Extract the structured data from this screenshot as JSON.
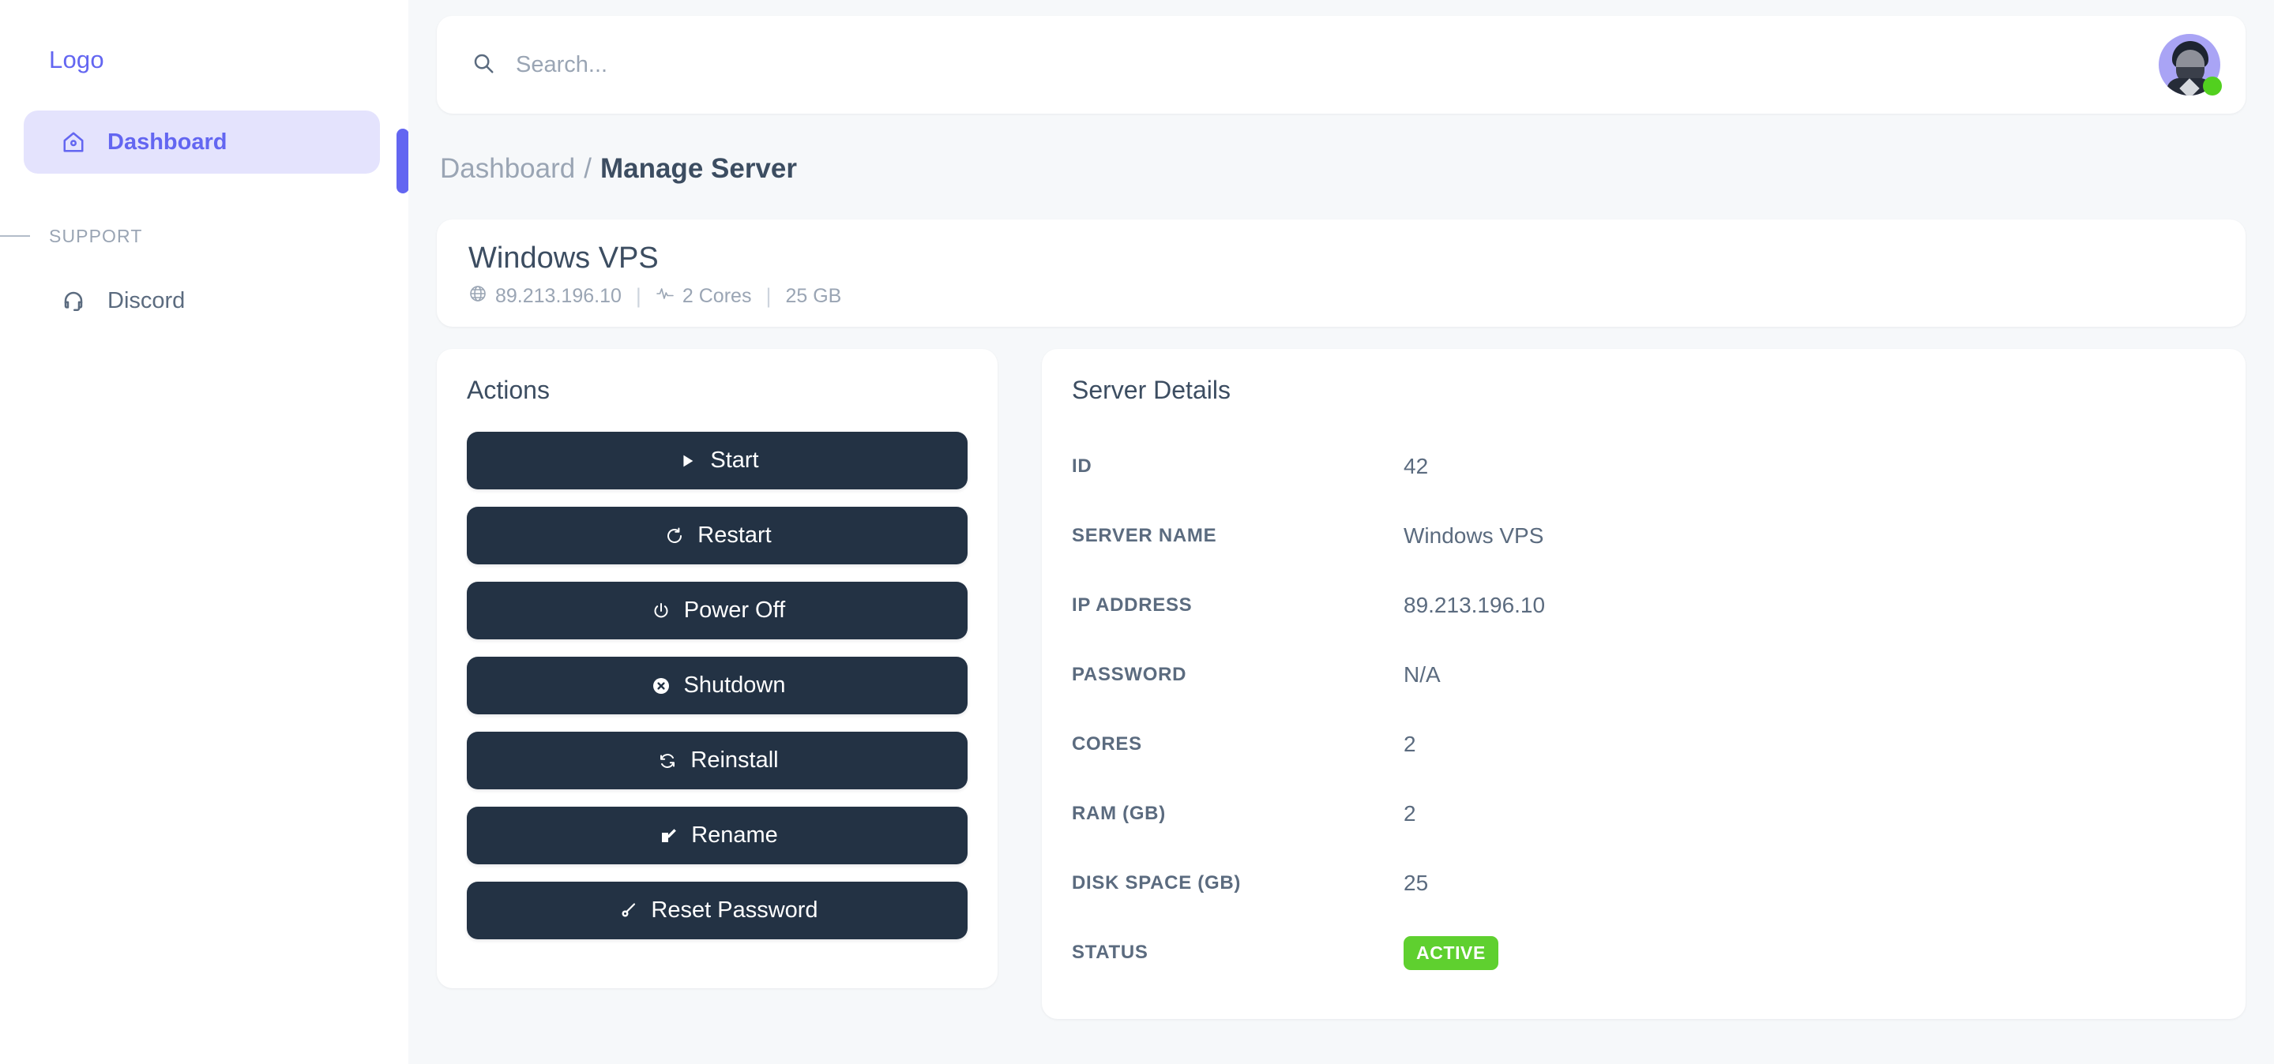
{
  "sidebar": {
    "logo": "Logo",
    "items": [
      {
        "label": "Dashboard",
        "icon": "home-icon",
        "active": true
      }
    ],
    "section_label": "SUPPORT",
    "support_items": [
      {
        "label": "Discord",
        "icon": "headset-icon"
      }
    ],
    "accent_color": "#6366f1"
  },
  "topbar": {
    "search_placeholder": "Search...",
    "search_value": "",
    "search_icon": "search-icon",
    "avatar_icon": "avatar",
    "status": "online",
    "status_color": "#52d01f"
  },
  "breadcrumb": {
    "root": "Dashboard",
    "separator": "/",
    "current": "Manage Server"
  },
  "server_header": {
    "title": "Windows VPS",
    "ip_icon": "globe-icon",
    "ip": "89.213.196.10",
    "cpu_icon": "activity-icon",
    "cores": "2 Cores",
    "disk": "25 GB",
    "separator": "|"
  },
  "actions_panel": {
    "title": "Actions",
    "buttons": [
      {
        "label": "Start",
        "icon": "play-icon"
      },
      {
        "label": "Restart",
        "icon": "restart-icon"
      },
      {
        "label": "Power Off",
        "icon": "power-icon"
      },
      {
        "label": "Shutdown",
        "icon": "x-circle-icon"
      },
      {
        "label": "Reinstall",
        "icon": "refresh-icon"
      },
      {
        "label": "Rename",
        "icon": "edit-icon"
      },
      {
        "label": "Reset Password",
        "icon": "key-icon"
      }
    ]
  },
  "details_panel": {
    "title": "Server Details",
    "rows": [
      {
        "key": "ID",
        "value": "42"
      },
      {
        "key": "SERVER NAME",
        "value": "Windows VPS"
      },
      {
        "key": "IP ADDRESS",
        "value": "89.213.196.10"
      },
      {
        "key": "PASSWORD",
        "value": "N/A"
      },
      {
        "key": "CORES",
        "value": "2"
      },
      {
        "key": "RAM (GB)",
        "value": "2"
      },
      {
        "key": "DISK SPACE (GB)",
        "value": "25"
      },
      {
        "key": "STATUS",
        "value": "ACTIVE",
        "is_badge": true,
        "badge_color": "#5fd02f"
      }
    ]
  }
}
